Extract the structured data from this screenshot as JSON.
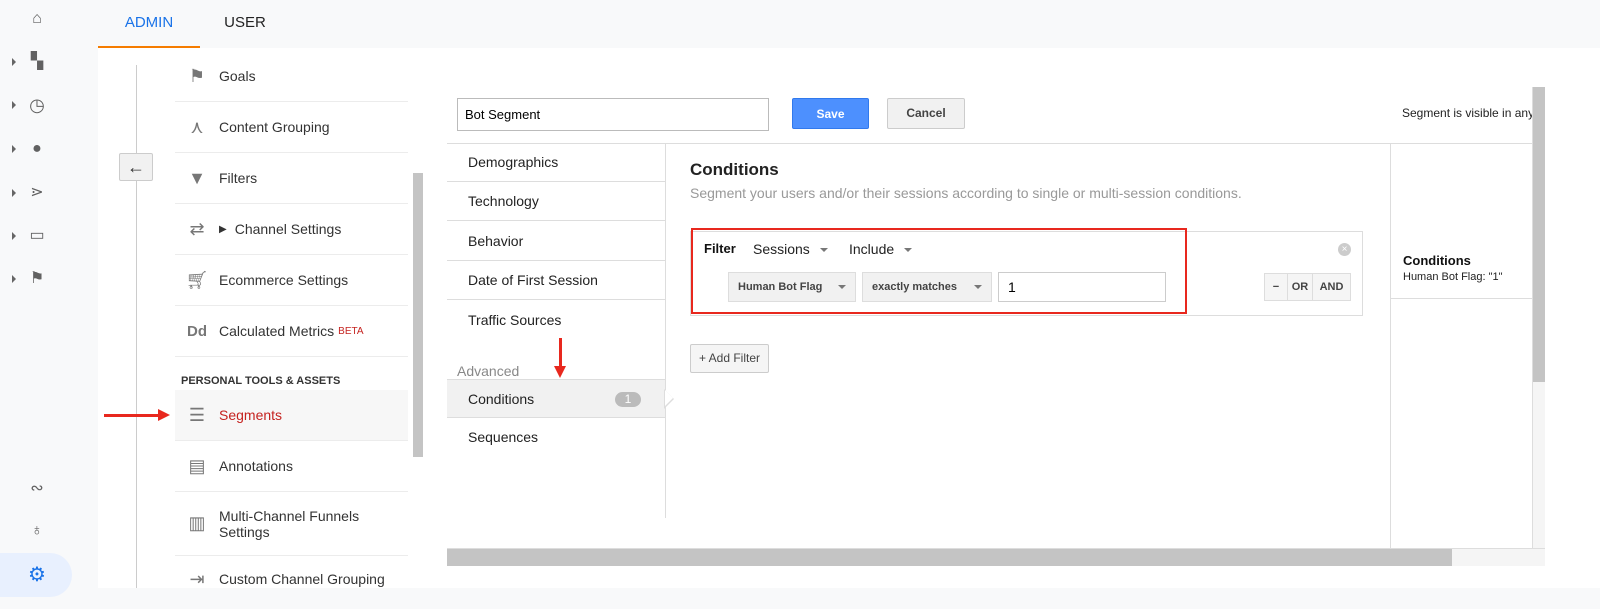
{
  "tabs": [
    {
      "label": "ADMIN",
      "active": true
    },
    {
      "label": "USER",
      "active": false
    }
  ],
  "rail_icons": [
    "home-icon",
    "dashboard-add-icon",
    "clock-icon",
    "person-icon",
    "acquisition-icon",
    "behavior-icon",
    "flag-icon",
    "path-icon",
    "lightbulb-icon",
    "gear-icon"
  ],
  "admin_nav": {
    "items": [
      {
        "label": "Goals",
        "icon": "flag-icon"
      },
      {
        "label": "Content Grouping",
        "icon": "merge-icon"
      },
      {
        "label": "Filters",
        "icon": "filter-icon"
      },
      {
        "label": "Channel Settings",
        "icon": "channel-icon"
      },
      {
        "label": "Ecommerce Settings",
        "icon": "cart-icon"
      },
      {
        "label": "Calculated Metrics",
        "badge": "BETA",
        "icon": "dd-icon"
      }
    ],
    "section_header": "PERSONAL TOOLS & ASSETS",
    "personal_items": [
      {
        "label": "Segments",
        "active": true
      },
      {
        "label": "Annotations"
      },
      {
        "label": "Multi-Channel Funnels Settings"
      },
      {
        "label": "Custom Channel Grouping"
      }
    ]
  },
  "editor": {
    "name_value": "Bot Segment",
    "save_label": "Save",
    "cancel_label": "Cancel",
    "visibility_text": "Segment is visible in any",
    "menu": [
      "Demographics",
      "Technology",
      "Behavior",
      "Date of First Session",
      "Traffic Sources"
    ],
    "advanced_label": "Advanced",
    "advanced_items": [
      {
        "label": "Conditions",
        "count": "1",
        "active": true
      },
      {
        "label": "Sequences"
      }
    ],
    "conditions": {
      "title": "Conditions",
      "subtitle": "Segment your users and/or their sessions according to single or multi-session conditions.",
      "filter_label": "Filter",
      "scope": "Sessions",
      "mode": "Include",
      "dimension": "Human Bot Flag",
      "operator": "exactly matches",
      "value": "1",
      "minus_label": "−",
      "or_label": "OR",
      "and_label": "AND",
      "add_filter_label": "+ Add Filter"
    },
    "summary": {
      "title": "Conditions",
      "text": "Human Bot Flag: \"1\""
    }
  },
  "colors": {
    "accent_blue": "#1a73e8",
    "tab_underline": "#f57c00",
    "save_blue": "#4d90fe",
    "annotation_red": "#e8281e",
    "active_red": "#c5221f"
  }
}
